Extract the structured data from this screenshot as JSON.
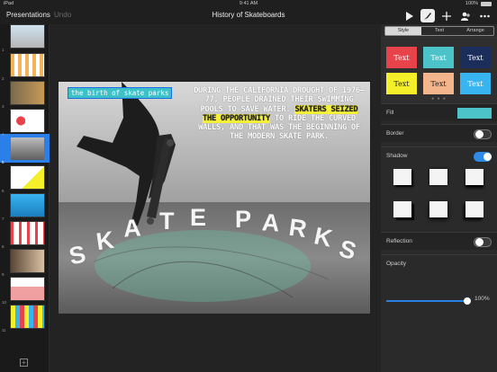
{
  "status": {
    "carrier": "iPad",
    "time": "9:41 AM",
    "battery": "100%"
  },
  "toolbar": {
    "presentations": "Presentations",
    "undo": "Undo",
    "title": "History of Skateboards"
  },
  "icons": [
    "play-icon",
    "format-brush-icon",
    "add-icon",
    "collaborate-icon",
    "more-icon"
  ],
  "thumbnails": [
    {
      "num": "1"
    },
    {
      "num": "2"
    },
    {
      "num": "3"
    },
    {
      "num": "4"
    },
    {
      "num": "5"
    },
    {
      "num": "6"
    },
    {
      "num": "7"
    },
    {
      "num": "8"
    },
    {
      "num": "9"
    },
    {
      "num": "10"
    },
    {
      "num": "11"
    }
  ],
  "selected_slide": 5,
  "slide": {
    "label": "the birth of skate parks",
    "body_before": "DURING THE CALIFORNIA DROUGHT OF 1976–77, PEOPLE DRAINED THEIR SWIMMING POOLS TO SAVE WATER.",
    "body_highlight": "SKATERS SEIZED THE OPPORTUNITY",
    "body_after": "TO RIDE THE CURVED WALLS, AND THAT WAS THE BEGINNING OF THE MODERN SKATE PARK.",
    "big_word_letters": [
      "S",
      "K",
      "A",
      "T",
      "E",
      "P",
      "A",
      "R",
      "K",
      "S"
    ]
  },
  "inspector": {
    "tabs": [
      "Style",
      "Text",
      "Arrange"
    ],
    "active_tab": "Style",
    "style_chips": [
      {
        "label": "Text",
        "bg": "#e8434b",
        "fg": "#ffffff"
      },
      {
        "label": "Text",
        "bg": "#4cc3c8",
        "fg": "#ffffff"
      },
      {
        "label": "Text",
        "bg": "#1b2d5a",
        "fg": "#ffffff"
      },
      {
        "label": "Text",
        "bg": "#f5ef2a",
        "fg": "#222222"
      },
      {
        "label": "Text",
        "bg": "#f4b48c",
        "fg": "#222222"
      },
      {
        "label": "Text",
        "bg": "#38b4f0",
        "fg": "#ffffff"
      }
    ],
    "fill_label": "Fill",
    "fill_color": "#4cc3c8",
    "border_label": "Border",
    "border_on": false,
    "shadow_label": "Shadow",
    "shadow_on": true,
    "reflection_label": "Reflection",
    "reflection_on": false,
    "opacity_label": "Opacity",
    "opacity_value": "100%"
  }
}
